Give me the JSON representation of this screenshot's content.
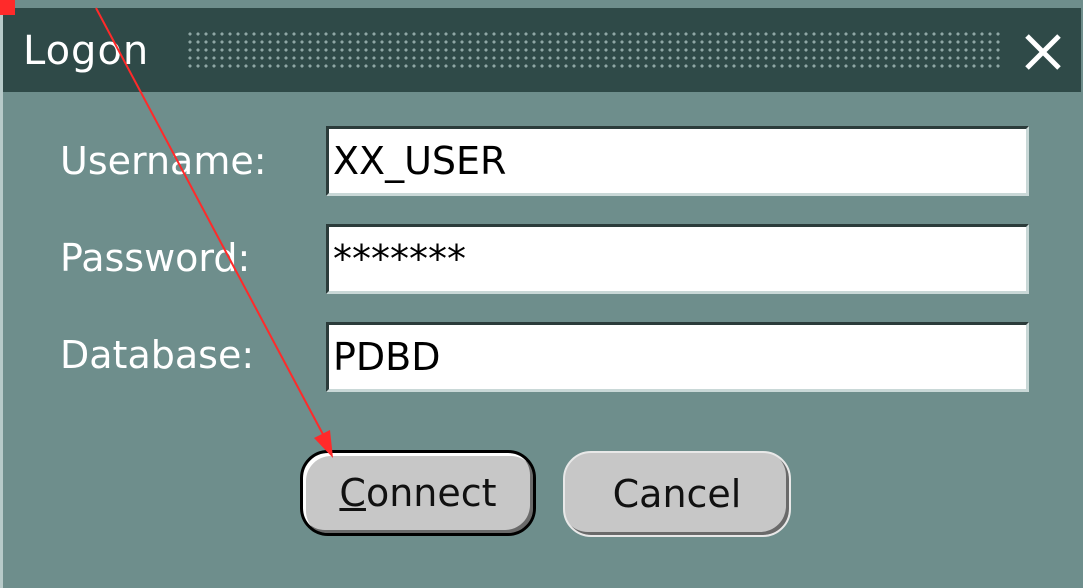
{
  "window": {
    "title": "Logon",
    "close_glyph": "✕"
  },
  "form": {
    "username_label": "Username:",
    "username_value": "XX_USER",
    "password_label": "Password:",
    "password_value": "*******",
    "database_label": "Database:",
    "database_value": "PDBD"
  },
  "buttons": {
    "connect_mnemonic": "C",
    "connect_rest": "onnect",
    "cancel_label": "Cancel"
  },
  "colors": {
    "dialog_bg": "#6e8e8c",
    "titlebar_bg": "#2f4a48",
    "button_bg": "#c7c7c7",
    "annotation": "#ff2a2a"
  },
  "icons": {
    "close": "close-icon"
  }
}
